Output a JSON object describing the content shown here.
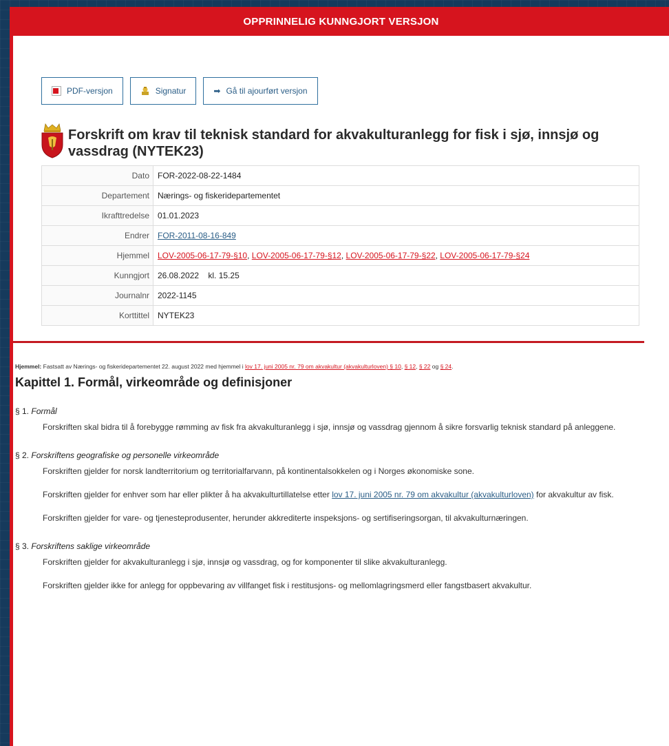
{
  "banner": "OPPRINNELIG KUNNGJORT VERSJON",
  "toolbar": {
    "pdf_label": "PDF-versjon",
    "signatur_label": "Signatur",
    "goto_label": "Gå til ajourført versjon"
  },
  "title": "Forskrift om krav til teknisk standard for akvakulturanlegg for fisk i sjø, innsjø og vassdrag (NYTEK23)",
  "meta": {
    "dato_label": "Dato",
    "dato": "FOR-2022-08-22-1484",
    "dep_label": "Departement",
    "dep": "Nærings- og fiskeridepartementet",
    "ikraft_label": "Ikrafttredelse",
    "ikraft": "01.01.2023",
    "endrer_label": "Endrer",
    "endrer": "FOR-2011-08-16-849",
    "hjemmel_label": "Hjemmel",
    "hjemmel_1": "LOV-2005-06-17-79-§10",
    "hjemmel_2": "LOV-2005-06-17-79-§12",
    "hjemmel_3": "LOV-2005-06-17-79-§22",
    "hjemmel_4": "LOV-2005-06-17-79-§24",
    "kunngjort_label": "Kunngjort",
    "kunngjort": "26.08.2022    kl. 15.25",
    "journal_label": "Journalnr",
    "journal": "2022-1145",
    "korttittel_label": "Korttittel",
    "korttittel": "NYTEK23"
  },
  "hjemmel_line": {
    "label": "Hjemmel:",
    "text": " Fastsatt av Nærings- og fiskeridepartementet 22. august 2022 med hjemmel i ",
    "law_link": "lov 17. juni 2005 nr. 79 om akvakultur (akvakulturloven) § 10",
    "s12": "§ 12",
    "s22": "§ 22",
    "og": " og ",
    "s24": "§ 24",
    "end": "."
  },
  "chapter_title": "Kapittel 1. Formål, virkeområde og definisjoner",
  "sections": {
    "s1_num": "§ 1.",
    "s1_title": "Formål",
    "s1_p1": "Forskriften skal bidra til å forebygge rømming av fisk fra akvakulturanlegg i sjø, innsjø og vassdrag gjennom å sikre forsvarlig teknisk standard på anleggene.",
    "s2_num": "§ 2.",
    "s2_title": "Forskriftens geografiske og personelle virkeområde",
    "s2_p1": "Forskriften gjelder for norsk landterritorium og territorialfarvann, på kontinentalsokkelen og i Norges økonomiske sone.",
    "s2_p2_pre": "Forskriften gjelder for enhver som har eller plikter å ha akvakulturtillatelse etter ",
    "s2_p2_link": "lov 17. juni 2005 nr. 79 om akvakultur (akvakulturloven)",
    "s2_p2_post": " for akvakultur av fisk.",
    "s2_p3": "Forskriften gjelder for vare- og tjenesteprodusenter, herunder akkrediterte inspeksjons- og sertifiseringsorgan, til akvakulturnæringen.",
    "s3_num": "§ 3.",
    "s3_title": "Forskriftens saklige virkeområde",
    "s3_p1": "Forskriften gjelder for akvakulturanlegg i sjø, innsjø og vassdrag, og for komponenter til slike akvakulturanlegg.",
    "s3_p2": "Forskriften gjelder ikke for anlegg for oppbevaring av villfanget fisk i restitusjons- og mellomlagringsmerd eller fangstbasert akvakultur."
  }
}
